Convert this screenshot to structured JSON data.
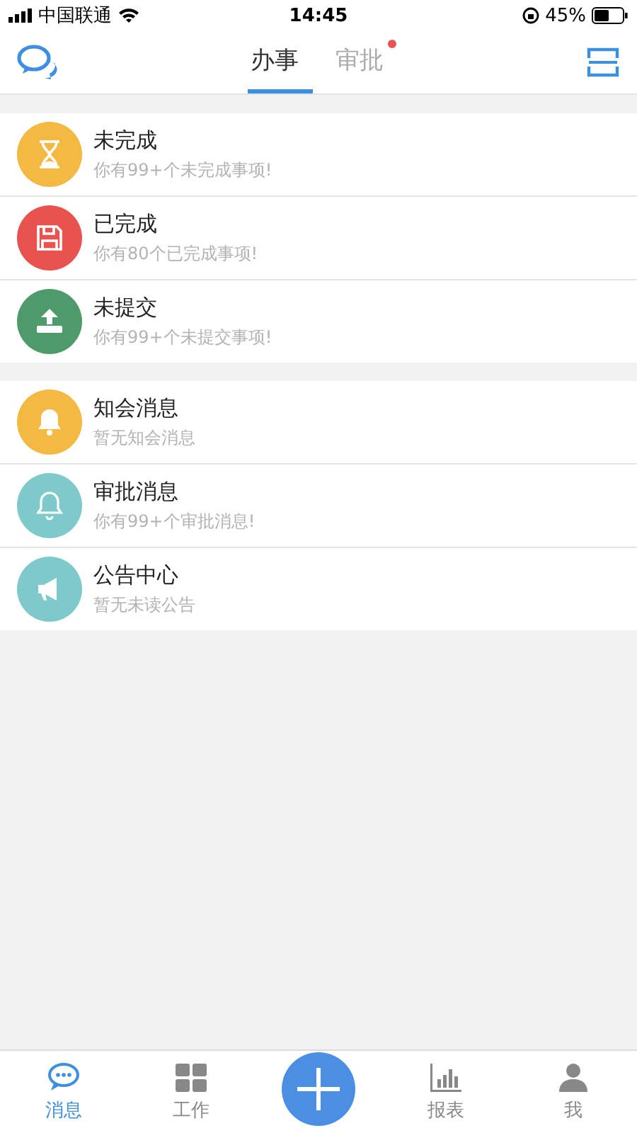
{
  "status_bar": {
    "carrier": "中国联通",
    "time": "14:45",
    "battery": "45%"
  },
  "header": {
    "tabs": [
      {
        "label": "办事",
        "selected": true,
        "dot": false
      },
      {
        "label": "审批",
        "selected": false,
        "dot": true
      }
    ]
  },
  "groups": [
    {
      "items": [
        {
          "kind": "hourglass",
          "color": "#f4b942",
          "title": "未完成",
          "subtitle": "你有99+个未完成事项!"
        },
        {
          "kind": "floppy",
          "color": "#e9534f",
          "title": "已完成",
          "subtitle": "你有80个已完成事项!"
        },
        {
          "kind": "upload",
          "color": "#4e9a6a",
          "title": "未提交",
          "subtitle": "你有99+个未提交事项!"
        }
      ]
    },
    {
      "items": [
        {
          "kind": "bell-filled",
          "color": "#f4b942",
          "title": "知会消息",
          "subtitle": "暂无知会消息"
        },
        {
          "kind": "bell-outline",
          "color": "#7ecaca",
          "title": "审批消息",
          "subtitle": "你有99+个审批消息!"
        },
        {
          "kind": "megaphone",
          "color": "#7ecaca",
          "title": "公告中心",
          "subtitle": "暂无未读公告"
        }
      ]
    }
  ],
  "tab_bar": [
    {
      "kind": "chat",
      "label": "消息",
      "selected": true
    },
    {
      "kind": "grid",
      "label": "工作",
      "selected": false
    },
    {
      "kind": "add"
    },
    {
      "kind": "chart",
      "label": "报表",
      "selected": false
    },
    {
      "kind": "person",
      "label": "我",
      "selected": false
    }
  ]
}
